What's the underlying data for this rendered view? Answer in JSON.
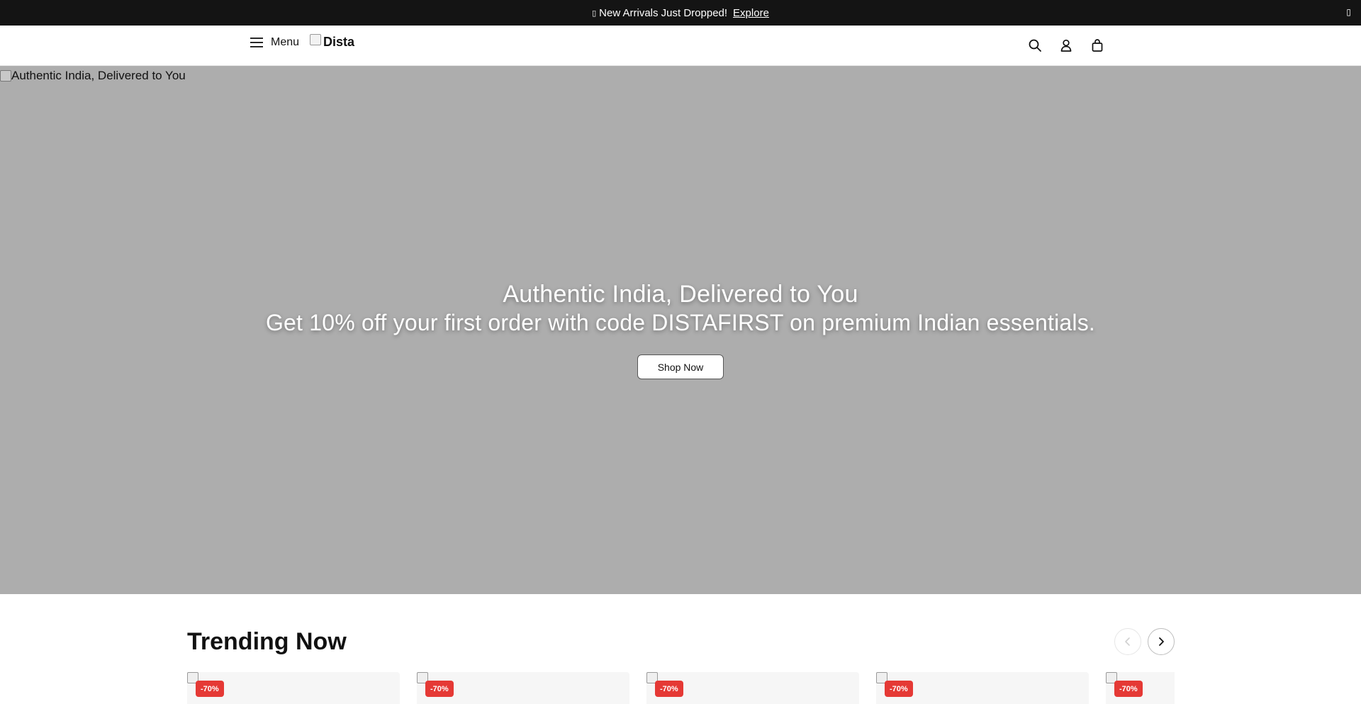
{
  "announcement": {
    "glyph": "▯",
    "text": "New Arrivals Just Dropped!",
    "link_label": "Explore",
    "close_glyph": "▯"
  },
  "header": {
    "menu_label": "Menu",
    "logo_alt": "Dista",
    "icons": [
      "search-icon",
      "account-icon",
      "cart-icon"
    ]
  },
  "hero": {
    "image_alt": "Authentic India, Delivered to You",
    "title": "Authentic India, Delivered to You",
    "subtitle": "Get 10% off your first order with code DISTAFIRST on premium Indian essentials.",
    "cta_label": "Shop Now",
    "background_color": "#adadad"
  },
  "trending": {
    "title": "Trending Now",
    "cards": [
      {
        "badge": "-70%"
      },
      {
        "badge": "-70%"
      },
      {
        "badge": "-70%"
      },
      {
        "badge": "-70%"
      },
      {
        "badge": "-70%"
      }
    ]
  },
  "colors": {
    "announcement_bg": "#141414",
    "badge": "#e53935"
  }
}
